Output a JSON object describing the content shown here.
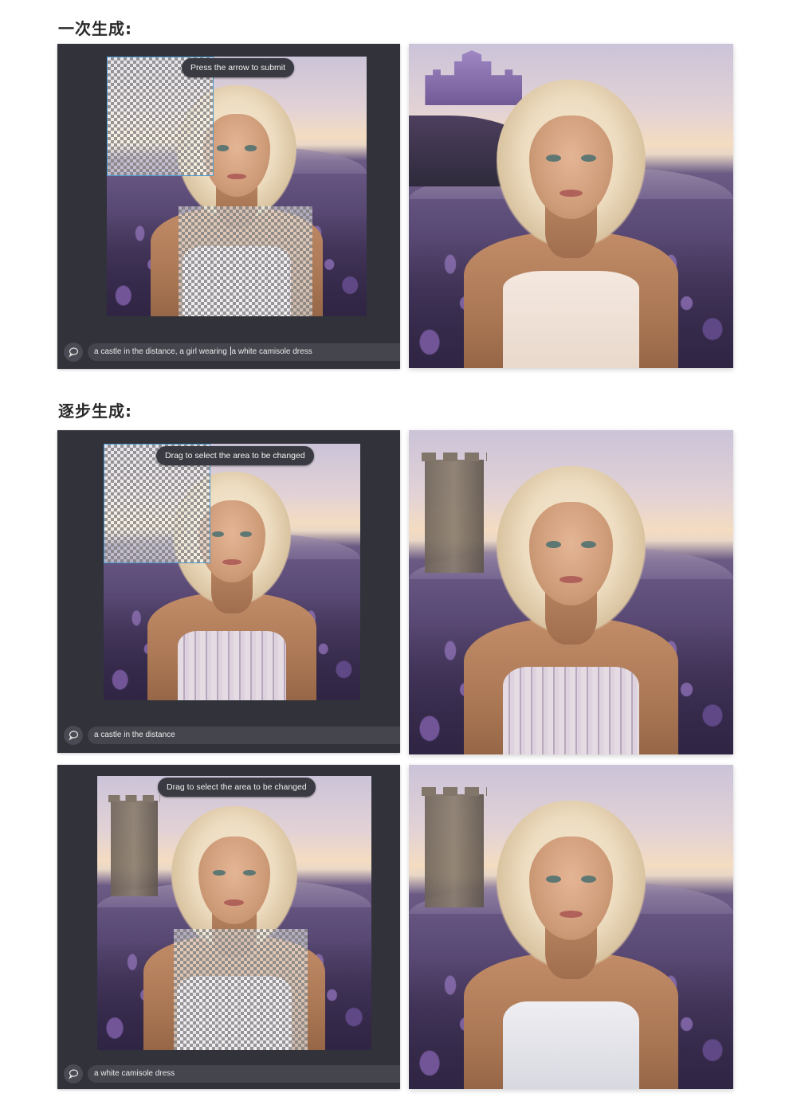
{
  "sections": {
    "one_shot": {
      "title": "一次生成:"
    },
    "step_by_step": {
      "title": "逐步生成:"
    }
  },
  "panels": [
    {
      "tooltip": "Press the arrow to submit",
      "prompt_before_caret": "a castle in the distance, a girl wearing ",
      "prompt_after_caret": "a white camisole dress",
      "result_variant": "castle-and-cream-dress"
    },
    {
      "tooltip": "Drag to select the area to be changed",
      "prompt_before_caret": "a castle in the distance",
      "prompt_after_caret": "",
      "result_variant": "tower-added"
    },
    {
      "tooltip": "Drag to select the area to be changed",
      "prompt_before_caret": "a white camisole dress",
      "prompt_after_caret": "",
      "result_variant": "tower-and-white-dress"
    }
  ],
  "icons": {
    "prompt_button": "chat-bubble-icon"
  },
  "colors": {
    "editor_bg": "#31323a",
    "selection_outline": "#4a9bd1",
    "tooltip_bg": "#3a3b42"
  }
}
